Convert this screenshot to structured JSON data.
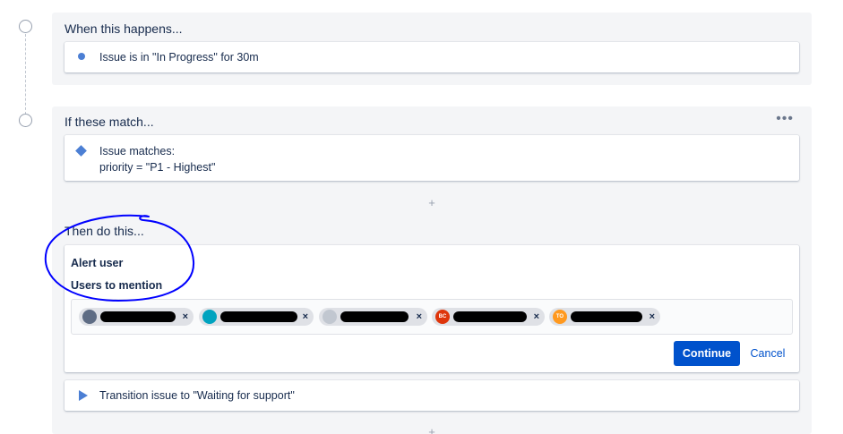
{
  "trigger": {
    "title": "When this happens...",
    "text": "Issue is in \"In Progress\" for 30m"
  },
  "condition": {
    "title": "If these match...",
    "line1": "Issue matches:",
    "line2": "priority = \"P1 - Highest\"",
    "add": "+"
  },
  "action": {
    "title": "Then do this...",
    "heading": "Alert user",
    "users_label": "Users to mention",
    "remove_glyph": "×",
    "avatars": [
      {
        "icon": "user-avatar-icon",
        "color": "#5e6c84",
        "initials": ""
      },
      {
        "icon": "user-avatar-icon",
        "color": "#00a3bf",
        "initials": ""
      },
      {
        "icon": "user-avatar-icon",
        "color": "#c1c7d0",
        "initials": ""
      },
      {
        "icon": "user-avatar-icon",
        "color": "#de350b",
        "initials": "BC"
      },
      {
        "icon": "user-avatar-icon",
        "color": "#ff991f",
        "initials": "TO"
      }
    ],
    "continue_label": "Continue",
    "cancel_label": "Cancel"
  },
  "next_action": {
    "text": "Transition issue to \"Waiting for support\""
  },
  "bottom_add": "+",
  "colors": {
    "accent": "#0052cc",
    "icon_blue": "#4c7fd4",
    "annotation": "#0000ff"
  }
}
